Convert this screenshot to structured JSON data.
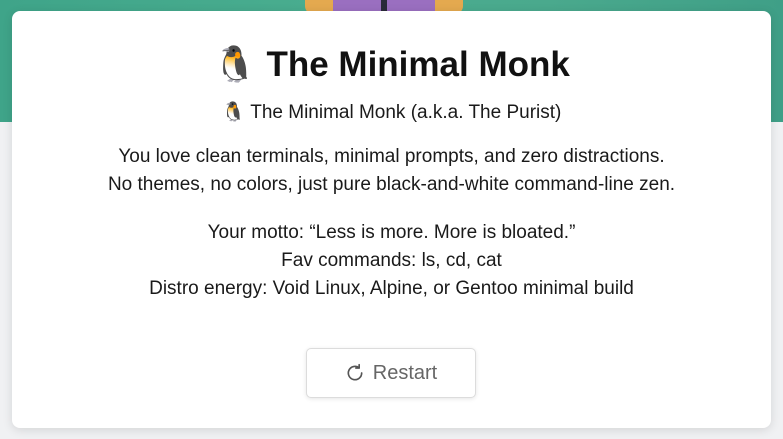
{
  "card": {
    "title": "🐧 The Minimal Monk",
    "subtitle": "🐧 The Minimal Monk (a.k.a. The Purist)",
    "description": [
      "You love clean terminals, minimal prompts, and zero distractions.",
      "No themes, no colors, just pure black-and-white command-line zen."
    ],
    "facts": [
      "Your motto: “Less is more. More is bloated.”",
      "Fav commands: ls, cd, cat",
      "Distro energy: Void Linux, Alpine, or Gentoo minimal build"
    ],
    "restart_label": "Restart",
    "restart_icon": "restart-icon"
  },
  "colors": {
    "background_gradient": "#46aa8d",
    "card": "#ffffff",
    "text": "#1a1a1a",
    "button_text": "#666666"
  }
}
